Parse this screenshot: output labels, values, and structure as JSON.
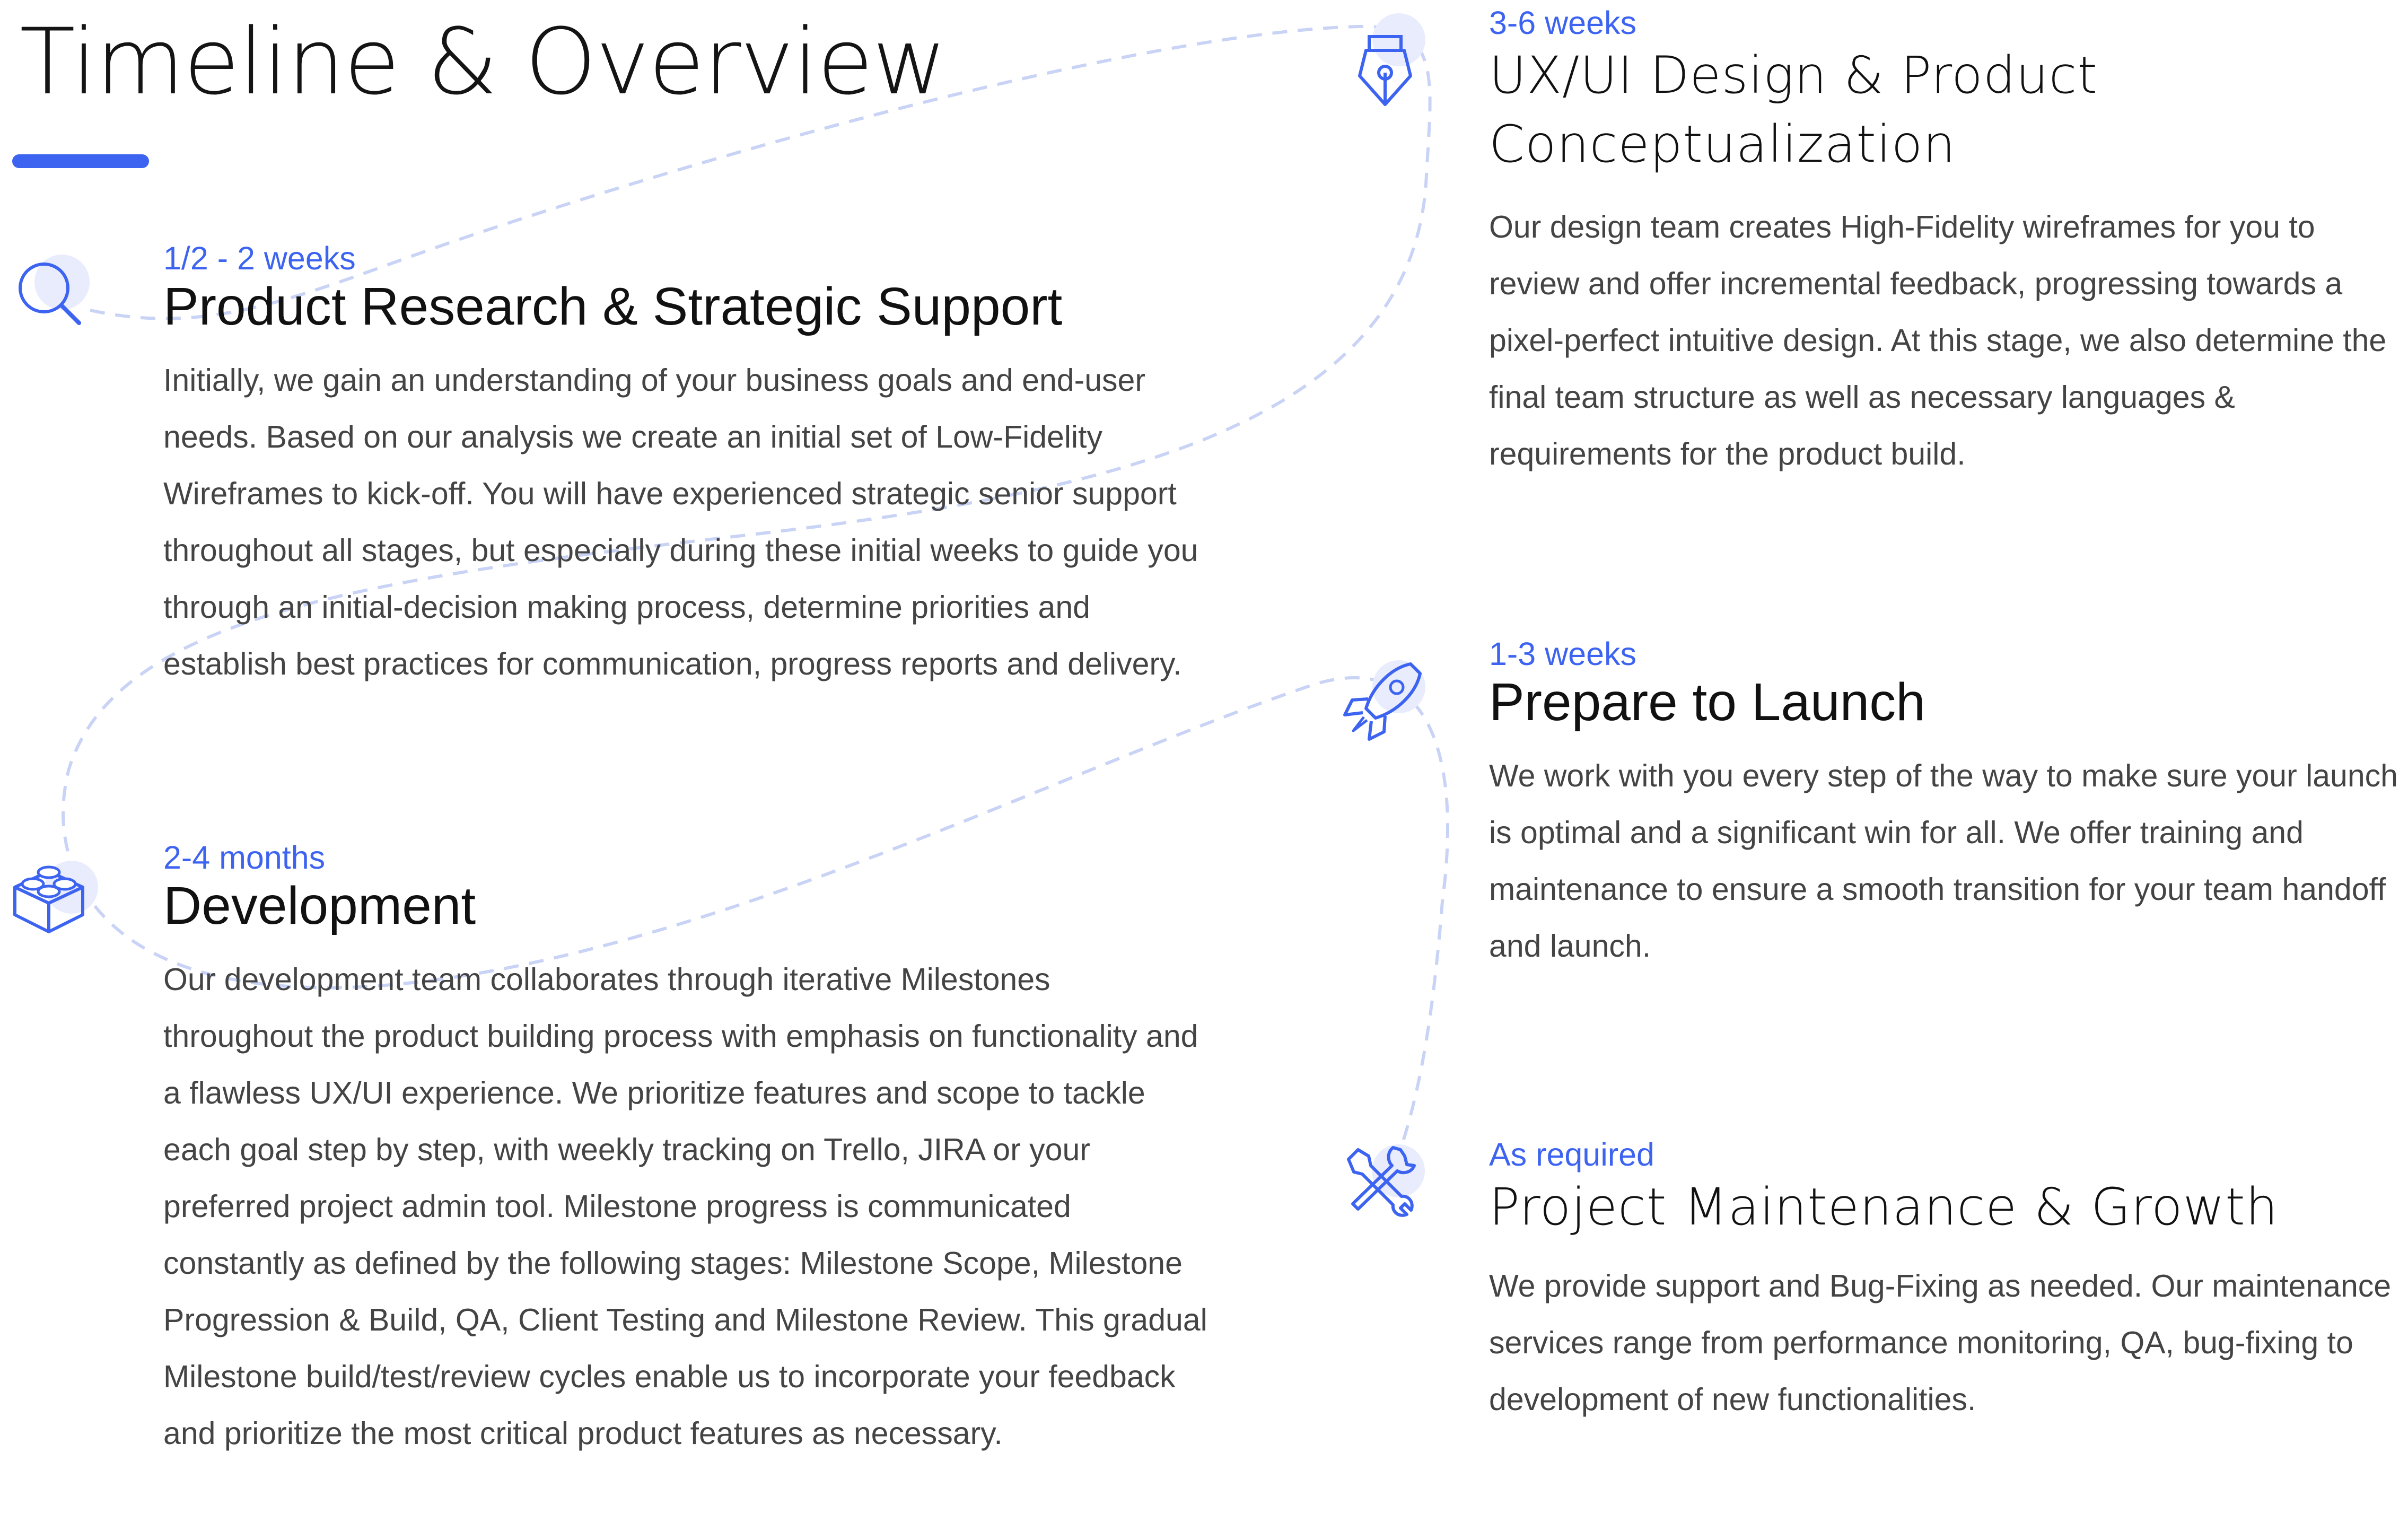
{
  "page": {
    "title": "Timeline & Overview",
    "accent_color": "#3d63f1",
    "path_color": "#c9d3f5",
    "icon_halo_color": "#e8ecfc"
  },
  "steps": [
    {
      "icon": "magnifier-icon",
      "duration": "1/2 - 2 weeks",
      "title": "Product Research & Strategic Support",
      "description": "Initially, we gain an understanding of your business goals and end-user needs. Based on our analysis we create an initial set of Low-Fidelity Wireframes to kick-off. You will have experienced strategic senior support throughout all stages, but especially during these initial weeks to guide you through an initial-decision making process, determine priorities and establish best practices for communication, progress reports and delivery."
    },
    {
      "icon": "pen-nib-icon",
      "duration": "3-6 weeks",
      "title": "UX/UI Design & Product Conceptualization",
      "description": "Our design team creates High-Fidelity wireframes for you to review and offer incremental feedback, progressing towards a pixel-perfect intuitive design. At this stage, we also determine the final team structure as well as necessary languages & requirements for the product build."
    },
    {
      "icon": "building-block-icon",
      "duration": "2-4 months",
      "title": "Development",
      "description": "Our development team collaborates through iterative Milestones throughout the product building process with emphasis on functionality and a flawless UX/UI experience. We prioritize features and scope to tackle each goal step by step, with weekly tracking on Trello, JIRA or your preferred project admin tool. Milestone progress is communicated constantly as defined by the following stages: Milestone Scope, Milestone Progression & Build, QA, Client Testing and Milestone Review. This gradual Milestone build/test/review cycles enable us to incorporate your feedback and prioritize the most critical product features as necessary."
    },
    {
      "icon": "rocket-icon",
      "duration": "1-3 weeks",
      "title": "Prepare to Launch",
      "description": "We work with you every step of the way to make sure your launch is optimal and a significant win for all. We offer training and maintenance to ensure a smooth transition for your team handoff and launch."
    },
    {
      "icon": "wrench-screwdriver-icon",
      "duration": "As required",
      "title": "Project Maintenance & Growth",
      "description": "We provide support and Bug-Fixing as needed. Our maintenance services range from performance monitoring, QA, bug-fixing to development of new functionalities."
    }
  ]
}
